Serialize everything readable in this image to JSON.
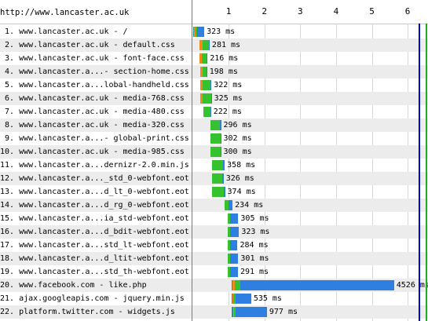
{
  "header": {
    "url": "http://www.lancaster.ac.uk",
    "scale_ticks": [
      "1",
      "2",
      "3",
      "4",
      "5",
      "6"
    ]
  },
  "markers": [
    {
      "name": "start-render-line",
      "seconds": 6.3,
      "color": "#0000cc"
    },
    {
      "name": "document-complete-line",
      "seconds": 6.5,
      "color": "#22aa22"
    }
  ],
  "colors": {
    "dns": "#1f9a88",
    "connect": "#f08a18",
    "ssl": "#c84bd8",
    "ttfb": "#35c22e",
    "download": "#2f7fe0",
    "alt_row": "#ececec"
  },
  "rows": [
    {
      "label": " 1. www.lancaster.ac.uk - /",
      "time": "323 ms",
      "start": 0.0,
      "dns": 0.04,
      "connect": 0.04,
      "ssl": 0,
      "ttfb": 0.05,
      "download": 0.19
    },
    {
      "label": " 2. www.lancaster.ac.uk - default.css",
      "time": "281 ms",
      "start": 0.19,
      "dns": 0,
      "connect": 0.08,
      "ssl": 0,
      "ttfb": 0.17,
      "download": 0.03
    },
    {
      "label": " 3. www.lancaster.ac.uk - font-face.css",
      "time": "216 ms",
      "start": 0.19,
      "dns": 0,
      "connect": 0.07,
      "ssl": 0,
      "ttfb": 0.12,
      "download": 0.03
    },
    {
      "label": " 4. www.lancaster.a...- section-home.css",
      "time": "198 ms",
      "start": 0.2,
      "dns": 0,
      "connect": 0.07,
      "ssl": 0,
      "ttfb": 0.11,
      "download": 0.02
    },
    {
      "label": " 5. www.lancaster.a...lobal-handheld.css",
      "time": "322 ms",
      "start": 0.2,
      "dns": 0,
      "connect": 0.07,
      "ssl": 0,
      "ttfb": 0.23,
      "download": 0.02
    },
    {
      "label": " 6. www.lancaster.ac.uk - media-768.css",
      "time": "325 ms",
      "start": 0.2,
      "dns": 0,
      "connect": 0.07,
      "ssl": 0,
      "ttfb": 0.24,
      "download": 0.02
    },
    {
      "label": " 7. www.lancaster.ac.uk - media-480.css",
      "time": "222 ms",
      "start": 0.29,
      "dns": 0,
      "connect": 0,
      "ssl": 0,
      "ttfb": 0.2,
      "download": 0.02
    },
    {
      "label": " 8. www.lancaster.ac.uk - media-320.css",
      "time": "296 ms",
      "start": 0.49,
      "dns": 0,
      "connect": 0,
      "ssl": 0,
      "ttfb": 0.27,
      "download": 0.03
    },
    {
      "label": " 9. www.lancaster.a...- global-print.css",
      "time": "302 ms",
      "start": 0.49,
      "dns": 0,
      "connect": 0,
      "ssl": 0,
      "ttfb": 0.28,
      "download": 0.02
    },
    {
      "label": "10. www.lancaster.ac.uk - media-985.css",
      "time": "300 ms",
      "start": 0.49,
      "dns": 0,
      "connect": 0,
      "ssl": 0,
      "ttfb": 0.28,
      "download": 0.02
    },
    {
      "label": "11. www.lancaster.a...dernizr-2.0.min.js",
      "time": "358 ms",
      "start": 0.53,
      "dns": 0,
      "connect": 0,
      "ssl": 0,
      "ttfb": 0.32,
      "download": 0.04
    },
    {
      "label": "12. www.lancaster.a..._std_0-webfont.eot",
      "time": "326 ms",
      "start": 0.53,
      "dns": 0,
      "connect": 0,
      "ssl": 0,
      "ttfb": 0.29,
      "download": 0.04
    },
    {
      "label": "13. www.lancaster.a...d_lt_0-webfont.eot",
      "time": "374 ms",
      "start": 0.53,
      "dns": 0,
      "connect": 0,
      "ssl": 0,
      "ttfb": 0.33,
      "download": 0.04
    },
    {
      "label": "14. www.lancaster.a...d_rg_0-webfont.eot",
      "time": "234 ms",
      "start": 0.88,
      "dns": 0,
      "connect": 0,
      "ssl": 0,
      "ttfb": 0.12,
      "download": 0.11
    },
    {
      "label": "15. www.lancaster.a...ia_std-webfont.eot",
      "time": "305 ms",
      "start": 0.97,
      "dns": 0,
      "connect": 0,
      "ssl": 0,
      "ttfb": 0.07,
      "download": 0.23
    },
    {
      "label": "16. www.lancaster.a...d_bdit-webfont.eot",
      "time": "323 ms",
      "start": 0.97,
      "dns": 0,
      "connect": 0,
      "ssl": 0,
      "ttfb": 0.07,
      "download": 0.25
    },
    {
      "label": "17. www.lancaster.a...std_lt-webfont.eot",
      "time": "284 ms",
      "start": 0.97,
      "dns": 0,
      "connect": 0,
      "ssl": 0,
      "ttfb": 0.07,
      "download": 0.21
    },
    {
      "label": "18. www.lancaster.a...d_ltit-webfont.eot",
      "time": "301 ms",
      "start": 0.97,
      "dns": 0,
      "connect": 0,
      "ssl": 0,
      "ttfb": 0.07,
      "download": 0.23
    },
    {
      "label": "19. www.lancaster.a...std_th-webfont.eot",
      "time": "291 ms",
      "start": 0.97,
      "dns": 0,
      "connect": 0,
      "ssl": 0,
      "ttfb": 0.07,
      "download": 0.22
    },
    {
      "label": "20. www.facebook.com - like.php",
      "time": "4526 ms",
      "start": 1.09,
      "dns": 0.02,
      "connect": 0.06,
      "ssl": 0.01,
      "ttfb": 0.15,
      "download": 4.29
    },
    {
      "label": "21. ajax.googleapis.com - jquery.min.js",
      "time": "535 ms",
      "start": 1.09,
      "dns": 0.02,
      "connect": 0.03,
      "ssl": 0,
      "ttfb": 0.05,
      "download": 0.44
    },
    {
      "label": "22. platform.twitter.com - widgets.js",
      "time": "977 ms",
      "start": 1.09,
      "dns": 0.03,
      "connect": 0.03,
      "ssl": 0,
      "ttfb": 0.04,
      "download": 0.88
    }
  ]
}
